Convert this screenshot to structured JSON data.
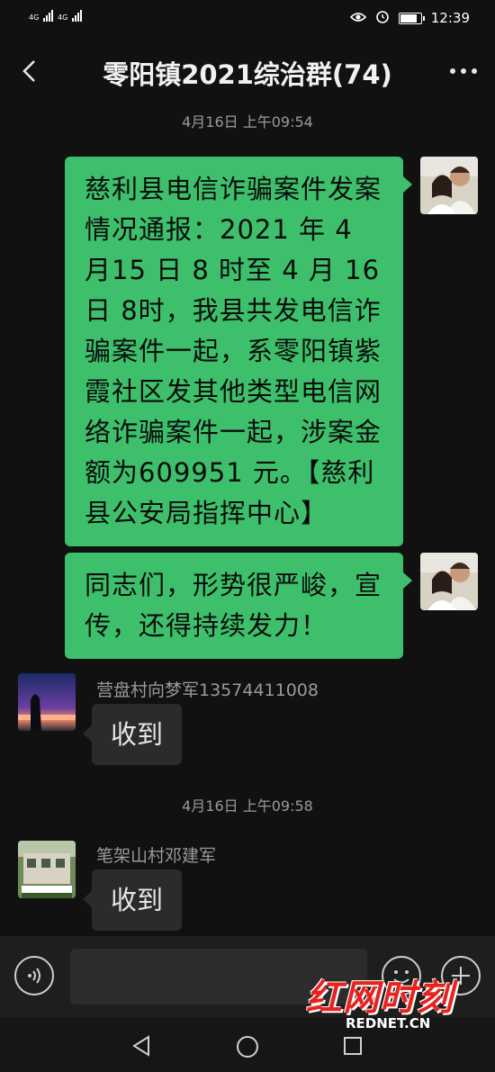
{
  "status_bar": {
    "signal_1": "4G",
    "signal_2": "4G",
    "time": "12:39",
    "battery_level": 0.9
  },
  "header": {
    "title": "零阳镇2021综治群(74)"
  },
  "timestamps": [
    "4月16日 上午09:54",
    "4月16日 上午09:58"
  ],
  "messages": [
    {
      "type": "outgoing",
      "text": "慈利县电信诈骗案件发案情况通报：2021 年 4 月15 日 8 时至 4 月 16 日 8时，我县共发电信诈骗案件一起，系零阳镇紫霞社区发其他类型电信网络诈骗案件一起，涉案金额为609951 元。【慈利县公安局指挥中心】"
    },
    {
      "type": "outgoing",
      "text": "同志们，形势很严峻，宣传，还得持续发力！"
    },
    {
      "type": "incoming",
      "sender": "营盘村向梦军13574411008",
      "text": "收到"
    },
    {
      "type": "incoming",
      "sender": "笔架山村邓建军",
      "text": "收到"
    }
  ],
  "watermark": {
    "logo": "红网时刻",
    "site": "REDNET.CN"
  },
  "icons": {
    "back": "chevron-left-icon",
    "more": "more-dots-icon",
    "voice": "voice-icon",
    "emoji": "emoji-icon",
    "plus": "plus-icon",
    "eye": "eye-icon",
    "alarm": "alarm-icon",
    "nav_back": "triangle-back-icon",
    "nav_home": "circle-home-icon",
    "nav_recent": "square-recent-icon"
  },
  "colors": {
    "bubble_outgoing": "#3ebf6b",
    "bubble_incoming": "#2b2b2b",
    "background": "#111111"
  }
}
